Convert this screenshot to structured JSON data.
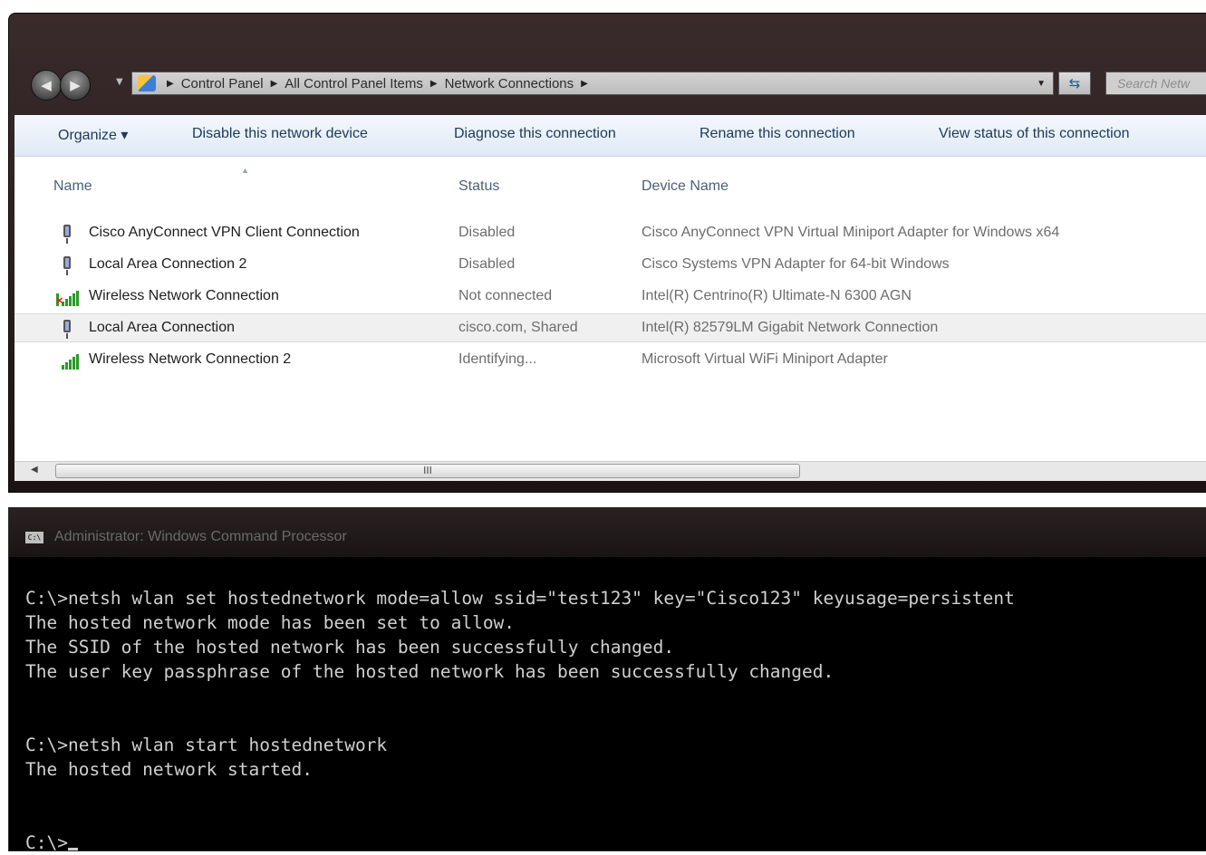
{
  "explorer": {
    "breadcrumbs": [
      "Control Panel",
      "All Control Panel Items",
      "Network Connections"
    ],
    "search_placeholder": "Search Netw",
    "toolbar": {
      "organize": "Organize ▾",
      "disable": "Disable this network device",
      "diagnose": "Diagnose this connection",
      "rename": "Rename this connection",
      "view_status": "View status of this connection"
    },
    "columns": {
      "name": "Name",
      "status": "Status",
      "device": "Device Name"
    },
    "rows": [
      {
        "name": "Cisco AnyConnect VPN Client Connection",
        "status": "Disabled",
        "device": "Cisco AnyConnect VPN Virtual Miniport Adapter for Windows x64",
        "icon": "wired-adapter-icon"
      },
      {
        "name": "Local Area Connection 2",
        "status": "Disabled",
        "device": "Cisco Systems VPN Adapter for 64-bit Windows",
        "icon": "wired-adapter-icon"
      },
      {
        "name": "Wireless Network Connection",
        "status": "Not connected",
        "device": "Intel(R) Centrino(R) Ultimate-N 6300 AGN",
        "icon": "wireless-disconnected-icon"
      },
      {
        "name": "Local Area Connection",
        "status": "cisco.com, Shared",
        "device": "Intel(R) 82579LM Gigabit Network Connection",
        "icon": "wired-adapter-icon"
      },
      {
        "name": "Wireless Network Connection 2",
        "status": "Identifying...",
        "device": "Microsoft Virtual WiFi Miniport Adapter",
        "icon": "wireless-signal-icon"
      }
    ],
    "scroll_grip": "III"
  },
  "cmd": {
    "title": "Administrator: Windows Command Processor",
    "icon_text": "C:\\",
    "lines": [
      "C:\\>netsh wlan set hostednetwork mode=allow ssid=\"test123\" key=\"Cisco123\" keyusage=persistent",
      "The hosted network mode has been set to allow.",
      "The SSID of the hosted network has been successfully changed.",
      "The user key passphrase of the hosted network has been successfully changed.",
      "",
      "",
      "C:\\>netsh wlan start hostednetwork",
      "The hosted network started.",
      "",
      "",
      "C:\\>"
    ]
  }
}
